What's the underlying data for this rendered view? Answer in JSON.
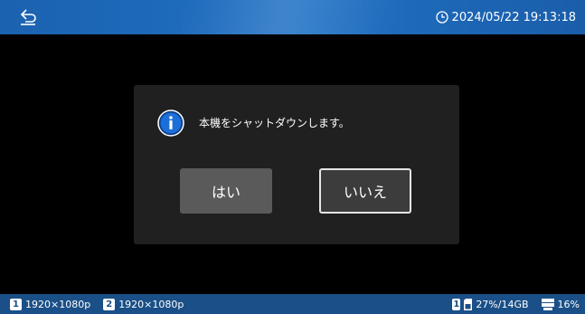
{
  "header": {
    "back_icon": "return-arrow-icon",
    "clock_icon": "clock-icon",
    "datetime": "2024/05/22 19:13:18"
  },
  "dialog": {
    "icon": "info-icon",
    "message": "本機をシャットダウンします。",
    "yes_label": "はい",
    "no_label": "いいえ"
  },
  "statusbar": {
    "outputs": [
      {
        "number": "1",
        "resolution": "1920×1080p"
      },
      {
        "number": "2",
        "resolution": "1920×1080p"
      }
    ],
    "sd_icon": "sd-card-icon",
    "sd_slot": "1",
    "sd_usage": "27%/14GB",
    "storage_icon": "hdd-icon",
    "storage_usage": "16%"
  },
  "colors": {
    "topbar": "#1f6bbd",
    "statusbar": "#1a4f87",
    "dialog_bg": "#202020",
    "button_yes": "#5a5a5a",
    "button_no": "#3c3c3c"
  }
}
